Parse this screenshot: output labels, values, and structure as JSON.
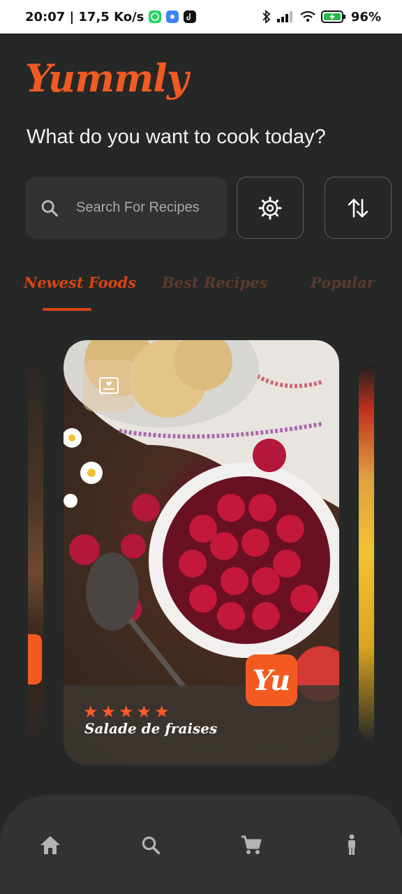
{
  "status_bar": {
    "time_speed": "20:07 | 17,5 Ko/s",
    "battery": "96%"
  },
  "app": {
    "logo": "Yummly"
  },
  "header": {
    "question": "What do you want to cook today?"
  },
  "search": {
    "placeholder": "Search For Recipes"
  },
  "tabs": [
    {
      "label": "Newest Foods",
      "active": true
    },
    {
      "label": "Best Recipes",
      "active": false
    },
    {
      "label": "Popular",
      "active": false
    }
  ],
  "featured_card": {
    "title": "Salade de fraises",
    "rating": 5,
    "badge_text": "Yu"
  },
  "bottom_nav": [
    {
      "icon": "home-icon"
    },
    {
      "icon": "search-icon"
    },
    {
      "icon": "cart-icon"
    },
    {
      "icon": "person-icon"
    }
  ],
  "colors": {
    "accent": "#f15a22",
    "background": "#252826",
    "surface": "#303331",
    "inactive_tab": "#5a3a30"
  }
}
